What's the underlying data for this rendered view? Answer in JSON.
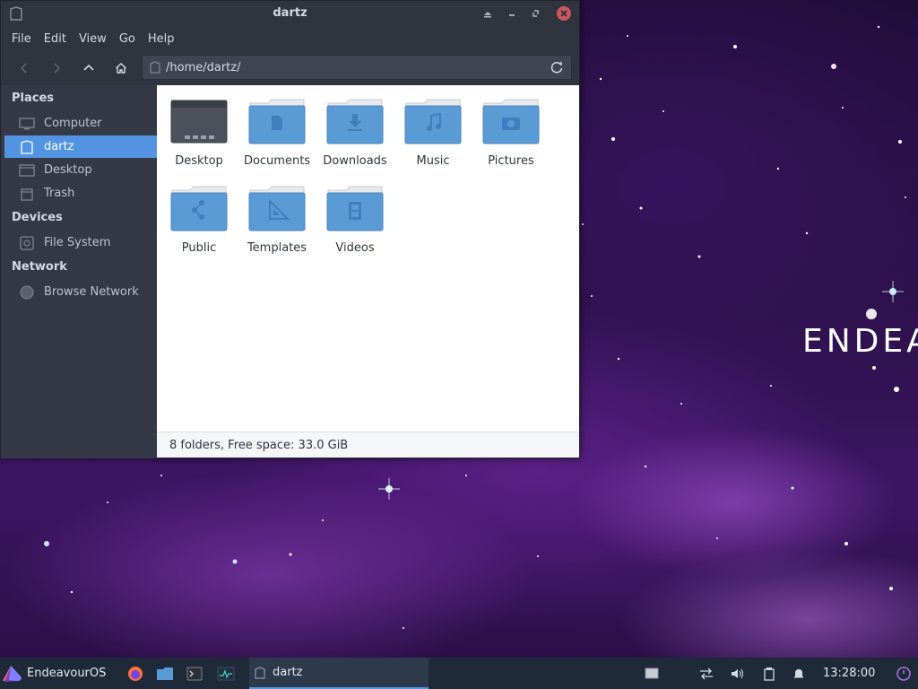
{
  "window": {
    "title": "dartz",
    "controls": [
      "minimize-icon",
      "restore-icon",
      "maximize-icon",
      "close-icon"
    ]
  },
  "menubar": {
    "items": [
      "File",
      "Edit",
      "View",
      "Go",
      "Help"
    ]
  },
  "toolbar": {
    "buttons": [
      "back-icon",
      "forward-icon",
      "up-icon",
      "home-icon"
    ],
    "location": "/home/dartz/",
    "reload_icon": "reload-icon"
  },
  "sidebar": {
    "sections": [
      {
        "heading": "Places",
        "items": [
          "Computer",
          "dartz",
          "Desktop",
          "Trash"
        ]
      },
      {
        "heading": "Devices",
        "items": [
          "File System"
        ]
      },
      {
        "heading": "Network",
        "items": [
          "Browse Network"
        ]
      }
    ],
    "selected": "dartz"
  },
  "files": [
    {
      "name": "Desktop",
      "icon": "desktop-folder-icon"
    },
    {
      "name": "Documents",
      "icon": "documents-folder-icon"
    },
    {
      "name": "Downloads",
      "icon": "downloads-folder-icon"
    },
    {
      "name": "Music",
      "icon": "music-folder-icon"
    },
    {
      "name": "Pictures",
      "icon": "pictures-folder-icon"
    },
    {
      "name": "Public",
      "icon": "public-folder-icon"
    },
    {
      "name": "Templates",
      "icon": "templates-folder-icon"
    },
    {
      "name": "Videos",
      "icon": "videos-folder-icon"
    }
  ],
  "status": "8 folders, Free space: 33.0 GiB",
  "desktop": {
    "brand_text": "ENDEAVOUR"
  },
  "taskbar": {
    "start_label": "EndeavourOS",
    "task_label": "dartz",
    "clock": "13:28:00"
  },
  "colors": {
    "accent": "#5294e2",
    "window_bg": "#2f343f",
    "sidebar_bg": "#353945",
    "folder_blue": "#5b9bd5",
    "close_red": "#cc575d",
    "taskbar_bg": "#1e2a38"
  }
}
